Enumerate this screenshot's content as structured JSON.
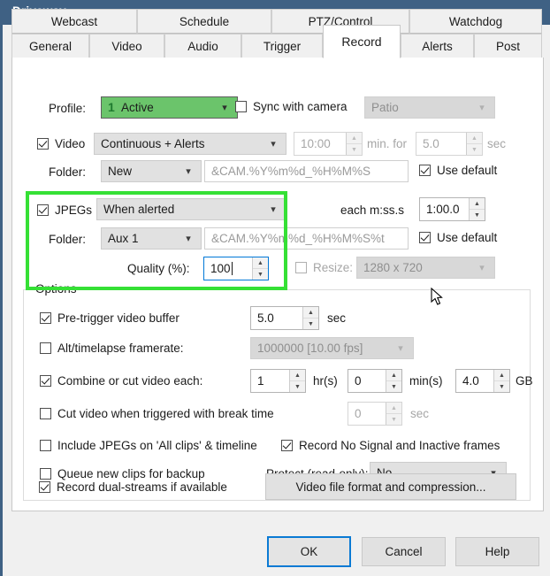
{
  "window": {
    "title": "Driveway",
    "titlebar_color": "#3f6184"
  },
  "tabs": {
    "row1": [
      {
        "label": "Webcast",
        "active": false
      },
      {
        "label": "Schedule",
        "active": false
      },
      {
        "label": "PTZ/Control",
        "active": false
      },
      {
        "label": "Watchdog",
        "active": false
      }
    ],
    "row2": [
      {
        "label": "General",
        "active": false
      },
      {
        "label": "Video",
        "active": false
      },
      {
        "label": "Audio",
        "active": false
      },
      {
        "label": "Trigger",
        "active": false
      },
      {
        "label": "Record",
        "active": true
      },
      {
        "label": "Alerts",
        "active": false
      },
      {
        "label": "Post",
        "active": false
      }
    ]
  },
  "profile_row": {
    "label": "Profile:",
    "profile_number": "1",
    "profile_value": "Active",
    "profile_color": "#6bc46b",
    "sync_label": "Sync with camera",
    "sync_checked": false,
    "camera_value": "Patio",
    "camera_disabled": true
  },
  "video_row": {
    "label": "Video",
    "checked": true,
    "mode_value": "Continuous + Alerts",
    "minutes_value": "10:00",
    "min_for_label": "min. for",
    "seconds_value": "5.0",
    "sec_label": "sec",
    "folder_label": "Folder:",
    "folder_value": "New",
    "path_value": "&CAM.%Y%m%d_%H%M%S",
    "use_default_label": "Use default",
    "use_default_checked": true
  },
  "jpegs_row": {
    "label": "JPEGs",
    "checked": true,
    "mode_value": "When alerted",
    "each_label": "each m:ss.s",
    "each_value": "1:00.0",
    "folder_label": "Folder:",
    "folder_value": "Aux 1",
    "path_value": "&CAM.%Y%m%d_%H%M%S%t",
    "use_default_label": "Use default",
    "use_default_checked": true,
    "quality_label": "Quality (%):",
    "quality_value": "100",
    "resize_label": "Resize:",
    "resize_checked": false,
    "resize_value": "1280 x 720",
    "highlight_color": "#35e035"
  },
  "options": {
    "title": "Options",
    "pretrigger": {
      "label": "Pre-trigger video buffer",
      "checked": true,
      "value": "5.0",
      "unit": "sec"
    },
    "alt_framerate": {
      "label": "Alt/timelapse framerate:",
      "checked": false,
      "value": "1000000 [10.00 fps]"
    },
    "combine_cut": {
      "label": "Combine or cut video each:",
      "checked": true,
      "hours": "1",
      "hours_unit": "hr(s)",
      "minutes": "0",
      "minutes_unit": "min(s)",
      "size": "4.0",
      "size_unit": "GB"
    },
    "cut_break": {
      "label": "Cut video when triggered with break time",
      "checked": false,
      "value": "0",
      "unit": "sec"
    },
    "include_jpegs": {
      "label": "Include JPEGs on 'All clips' & timeline",
      "checked": false
    },
    "record_nosignal": {
      "label": "Record No Signal and Inactive frames",
      "checked": true
    },
    "queue_backup": {
      "label": "Queue new clips for backup",
      "checked": false
    },
    "protect": {
      "label": "Protect (read-only):",
      "value": "No"
    },
    "dual_streams": {
      "label": "Record dual-streams if available",
      "checked": true
    },
    "video_format_button": "Video file format and compression..."
  },
  "buttons": {
    "ok": "OK",
    "cancel": "Cancel",
    "help": "Help"
  }
}
